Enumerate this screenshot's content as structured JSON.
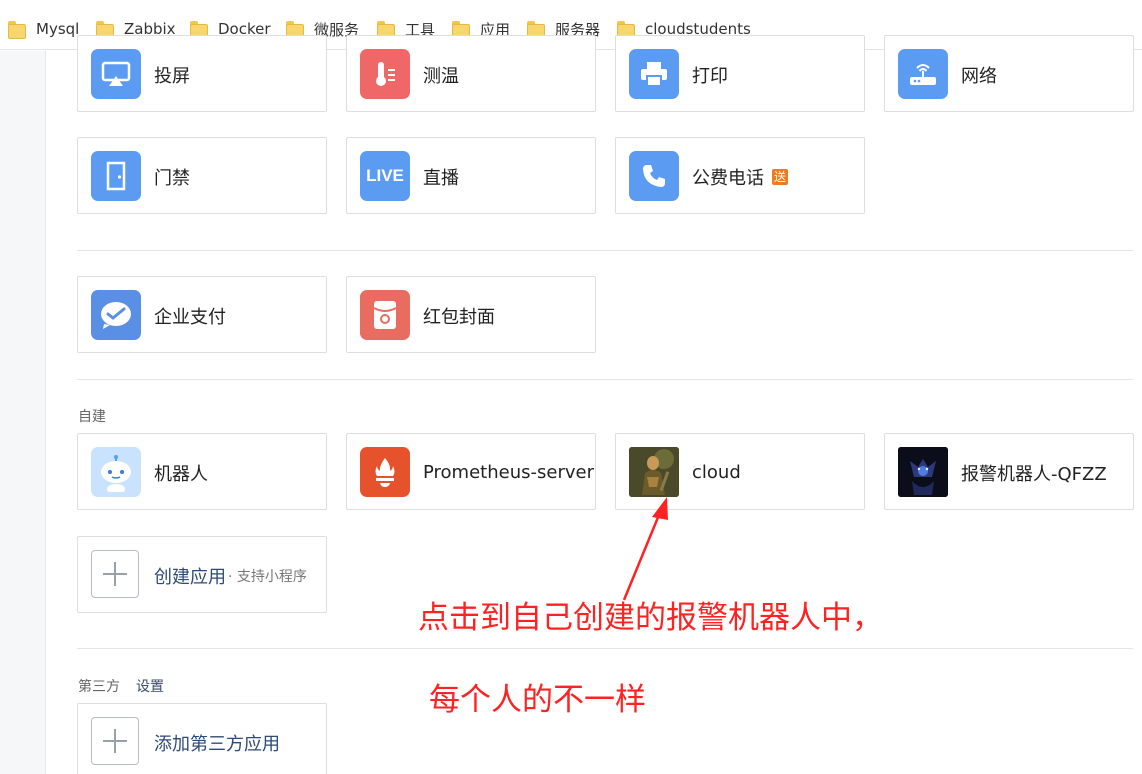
{
  "bookmarks": [
    {
      "label": "Mysql"
    },
    {
      "label": "Zabbix"
    },
    {
      "label": "Docker"
    },
    {
      "label": "微服务"
    },
    {
      "label": "工具"
    },
    {
      "label": "应用"
    },
    {
      "label": "服务器"
    },
    {
      "label": "cloudstudents"
    }
  ],
  "apps_row1": [
    {
      "label": "投屏",
      "icon": "screen-cast-icon"
    },
    {
      "label": "测温",
      "icon": "thermometer-icon"
    },
    {
      "label": "打印",
      "icon": "printer-icon"
    },
    {
      "label": "网络",
      "icon": "router-icon"
    }
  ],
  "apps_row2": [
    {
      "label": "门禁",
      "icon": "door-icon"
    },
    {
      "label": "直播",
      "icon": "live-icon",
      "icon_text": "LIVE"
    },
    {
      "label": "公费电话",
      "icon": "phone-icon",
      "badge": "送"
    }
  ],
  "apps_row3": [
    {
      "label": "企业支付",
      "icon": "pay-icon"
    },
    {
      "label": "红包封面",
      "icon": "red-envelope-icon"
    }
  ],
  "self_built": {
    "title": "自建",
    "apps": [
      {
        "label": "机器人",
        "icon": "robot-icon"
      },
      {
        "label": "Prometheus-server",
        "icon": "prometheus-icon"
      },
      {
        "label": "cloud",
        "icon": "cloud-avatar-icon"
      },
      {
        "label": "报警机器人-QFZZ",
        "icon": "alarm-bot-avatar-icon"
      }
    ],
    "create_label": "创建应用",
    "create_sub": "· 支持小程序"
  },
  "third_party": {
    "title": "第三方",
    "settings": "设置",
    "add_label": "添加第三方应用"
  },
  "annotation": {
    "line1": "点击到自己创建的报警机器人中，",
    "line2": "每个人的不一样"
  },
  "colors": {
    "icon_blue": "#5b9cf2",
    "icon_red": "#f06767",
    "prometheus": "#e6522c",
    "annotation": "#ff2222"
  }
}
